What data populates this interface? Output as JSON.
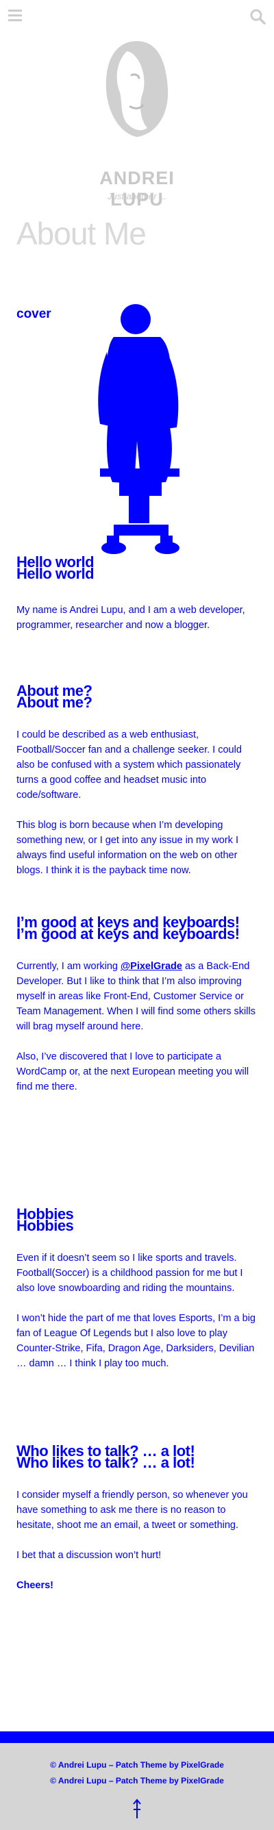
{
  "header": {
    "menu_icon": "hamburger-menu-icon",
    "search_icon": "search-icon"
  },
  "site": {
    "title": "ANDREI LUPU",
    "description": "Just another ..."
  },
  "page": {
    "title": "About Me",
    "cover_label": "cover"
  },
  "sections": [
    {
      "heading": "Hello world",
      "paragraphs": [
        "My name is Andrei Lupu, and I am a web developer, programmer, researcher and now a blogger."
      ]
    },
    {
      "heading": "About me?",
      "paragraphs": [
        "I could be described as a web enthusiast, Football/Soccer fan and a challenge seeker. I could also be confused with a system which passionately turns a good coffee and headset music into code/software.",
        "This blog is born because when I’m developing something new, or I get into any issue in my work I always find useful information on the web on other blogs. I think it is the payback time now."
      ]
    },
    {
      "heading": "I’m good at keys and keyboards!",
      "paragraphs": [
        "Currently, I am working @PixelGrade as a Back-End Developer. But I like to think that I’m also improving myself in areas like Front-End, Customer Service or Team Management. When I will find some others skills will brag myself around here.",
        "Also, I’ve discovered that I love to participate a WordCamp or, at the next European meeting you will find me there."
      ],
      "link": "@PixelGrade"
    },
    {
      "heading": "Hobbies",
      "paragraphs": [
        "Even if it doesn’t seem so I like sports and travels. Football(Soccer) is a childhood passion for me but I also love snowboarding and riding the mountains.",
        "I won’t hide the part of me that loves Esports, I’m a big fan of League Of Legends but I also love to play Counter-Strike, Fifa, Dragon Age, Darksiders, Devilian … damn … I think I play too much."
      ]
    },
    {
      "heading": "Who likes to talk? … a lot!",
      "paragraphs": [
        "I consider myself a friendly person, so whenever you have something to ask me there is no reason to hesitate, shoot me an email, a tweet or something.",
        "I bet that a discussion won’t hurt!"
      ]
    }
  ],
  "closing": "Cheers!",
  "footer": {
    "credit": "© Andrei Lupu – Patch Theme by PixelGrade",
    "to_top_icon": "arrow-up-icon"
  },
  "colors": {
    "text": "#0000ff",
    "muted": "#c8c8c8",
    "footer_bg": "#d5d5d5"
  }
}
